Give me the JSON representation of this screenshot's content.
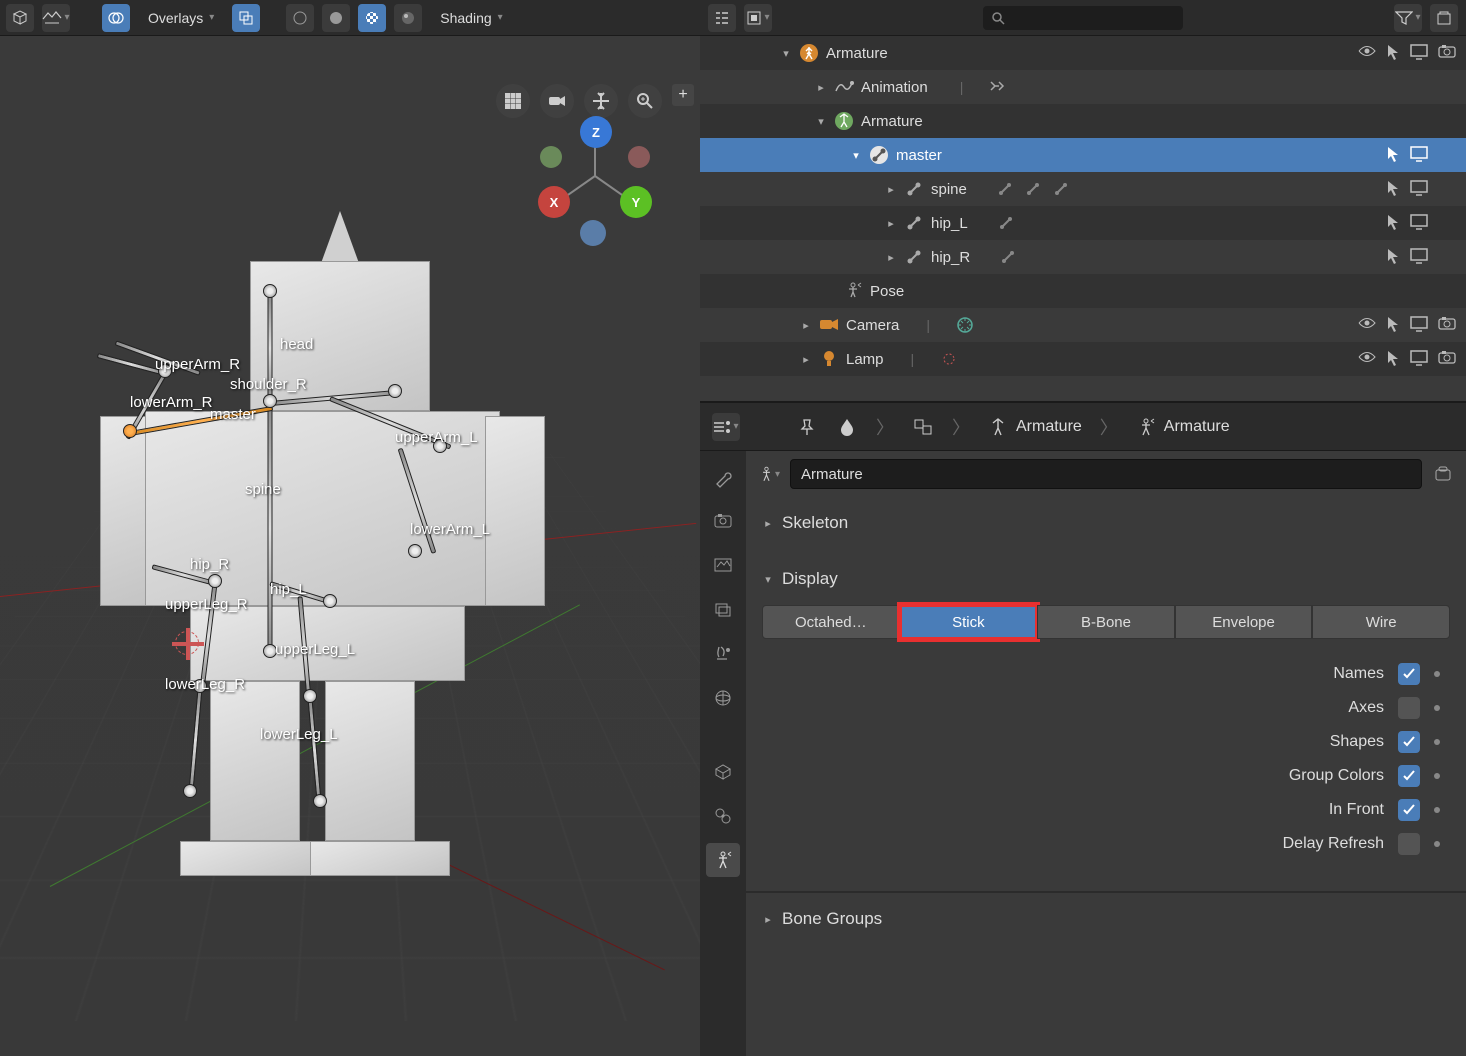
{
  "header3d": {
    "overlays": "Overlays",
    "shading": "Shading"
  },
  "bone_labels": {
    "head": "head",
    "upperArm_R": "upperArm_R",
    "shoulder_R": "shoulder_R",
    "lowerArm_R": "lowerArm_R",
    "master": "master",
    "upperArm_L": "upperArm_L",
    "spine": "spine",
    "lowerArm_L": "lowerArm_L",
    "hip_R": "hip_R",
    "hip_L": "hip_L",
    "upperLeg_R": "upperLeg_R",
    "upperLeg_L": "upperLeg_L",
    "lowerLeg_R": "lowerLeg_R",
    "lowerLeg_L": "lowerLeg_L"
  },
  "gizmo": {
    "x": "X",
    "y": "Y",
    "z": "Z"
  },
  "outliner": {
    "armature_obj": "Armature",
    "animation": "Animation",
    "armature_data": "Armature",
    "master": "master",
    "spine": "spine",
    "hip_L": "hip_L",
    "hip_R": "hip_R",
    "pose": "Pose",
    "camera": "Camera",
    "lamp": "Lamp"
  },
  "breadcrumb": {
    "armature1": "Armature",
    "armature2": "Armature"
  },
  "props": {
    "name_value": "Armature",
    "skeleton": "Skeleton",
    "display": "Display",
    "bone_groups": "Bone Groups",
    "enum": {
      "octahedral": "Octahed…",
      "stick": "Stick",
      "bbone": "B-Bone",
      "envelope": "Envelope",
      "wire": "Wire"
    },
    "checks": {
      "names": "Names",
      "axes": "Axes",
      "shapes": "Shapes",
      "group_colors": "Group Colors",
      "in_front": "In Front",
      "delay_refresh": "Delay Refresh"
    }
  }
}
